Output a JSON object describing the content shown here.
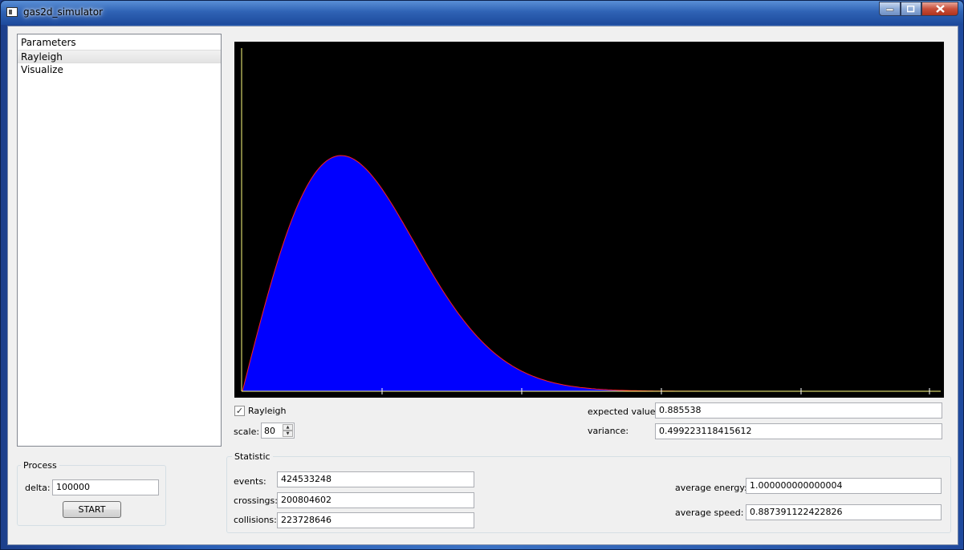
{
  "window": {
    "title": "gas2d_simulator",
    "minimize_icon": "minimize-icon",
    "maximize_icon": "maximize-icon",
    "close_icon": "close-icon"
  },
  "sidebar": {
    "items": [
      {
        "label": "Parameters",
        "selected": false
      },
      {
        "label": "Rayleigh",
        "selected": true
      },
      {
        "label": "Visualize",
        "selected": false
      }
    ]
  },
  "process": {
    "title": "Process",
    "delta_label": "delta:",
    "delta_value": "100000",
    "start_label": "START"
  },
  "rayleigh": {
    "checkbox_label": "Rayleigh",
    "checked": true,
    "scale_label": "scale:",
    "scale_value": "80",
    "expected_label": "expected value:",
    "expected_value": "0.885538",
    "variance_label": "variance:",
    "variance_value": "0.499223118415612"
  },
  "statistic": {
    "title": "Statistic",
    "events_label": "events:",
    "events_value": "424533248",
    "crossings_label": "crossings:",
    "crossings_value": "200804602",
    "collisions_label": "collisions:",
    "collisions_value": "223728646",
    "energy_label": "average energy:",
    "energy_value": "1.000000000000004",
    "speed_label": "average speed:",
    "speed_value": "0.887391122422826"
  },
  "chart_data": {
    "type": "area",
    "distribution": "rayleigh",
    "sigma": 0.7071,
    "x_range": [
      0,
      5
    ],
    "x_ticks": [
      1,
      2,
      3,
      4,
      5
    ],
    "fill_color": "#0000ff",
    "line_color": "#ff2020",
    "axis_color": "#ffff80",
    "background": "#000000"
  }
}
